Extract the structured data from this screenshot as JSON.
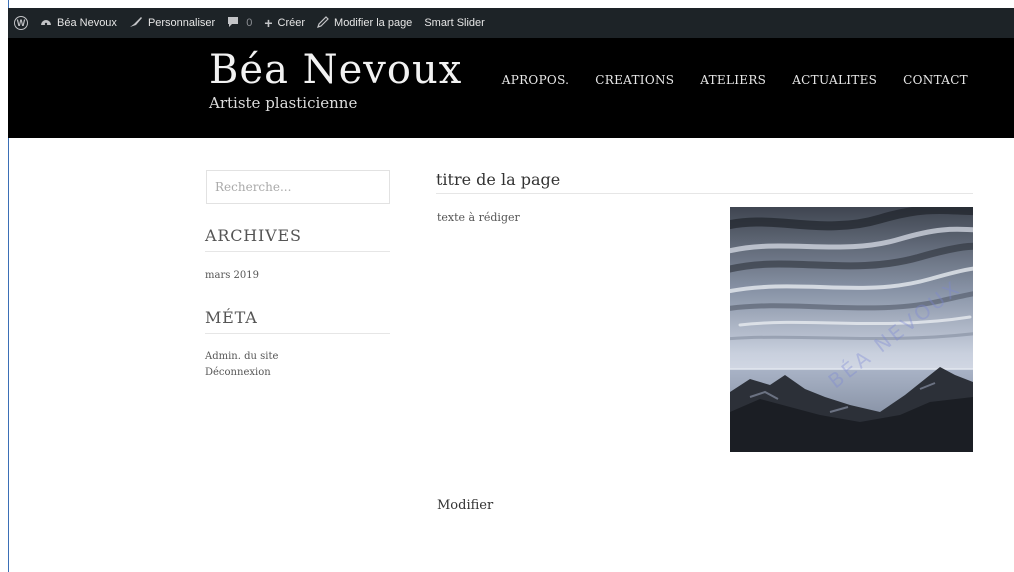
{
  "adminbar": {
    "site_name": "Béa Nevoux",
    "customize": "Personnaliser",
    "comments_count": "0",
    "create": "Créer",
    "edit_page": "Modifier la page",
    "smart_slider": "Smart Slider"
  },
  "header": {
    "site_title": "Béa Nevoux",
    "tagline": "Artiste plasticienne",
    "nav": [
      "APROPOS.",
      "CREATIONS",
      "ATELIERS",
      "ACTUALITES",
      "CONTACT"
    ]
  },
  "sidebar": {
    "search_placeholder": "Recherche...",
    "archives_title": "ARCHIVES",
    "archives_items": [
      "mars 2019"
    ],
    "meta_title": "MÉTA",
    "meta_items": [
      "Admin. du site",
      "Déconnexion"
    ]
  },
  "content": {
    "page_title": "titre de la page",
    "body_text": "texte à rédiger",
    "edit_link": "Modifier",
    "artwork_watermark": "BÉA NEVOUX"
  },
  "colors": {
    "adminbar_bg": "#1d2327",
    "header_bg": "#000000"
  },
  "icons": [
    "wordpress-icon",
    "dashboard-icon",
    "brush-icon",
    "comment-icon",
    "plus-icon",
    "pencil-icon"
  ]
}
